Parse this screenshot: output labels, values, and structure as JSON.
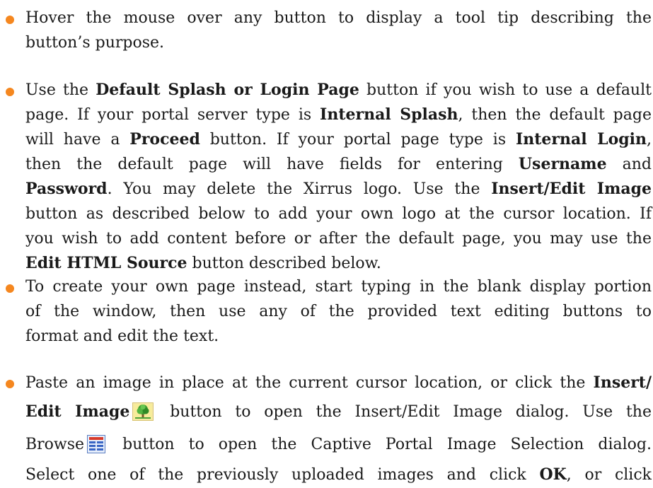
{
  "colors": {
    "bullet": "#f5871f",
    "text": "#1a1a1a"
  },
  "bullets": [
    {
      "lines": [
        "Hover the mouse over any button to display a tool tip describing the",
        "button’s purpose."
      ]
    },
    {
      "l1_a": "Use the ",
      "l1_b": "Default Splash or Login Page",
      "l1_c": " button if you wish to use a default",
      "l2_a": "page. If your portal server type is ",
      "l2_b": "Internal Splash",
      "l2_c": ", then the default page",
      "l3_a": "will have a ",
      "l3_b": "Proceed",
      "l3_c": " button. If your portal page type is ",
      "l3_d": "Internal Login",
      "l3_e": ",",
      "l4_a": "then the default page will have fields for entering ",
      "l4_b": "Username",
      "l4_c": " and",
      "l5_a": "Password",
      "l5_b": ". You may delete the Xirrus logo. Use the ",
      "l5_c": "Insert/Edit Image",
      "l6": "button as described below to add your own logo at the cursor location. If",
      "l7": "you wish to add content before or after the default page, you may use the",
      "l8_a": "Edit HTML Source",
      "l8_b": " button described below."
    },
    {
      "lines": [
        "To create your own page instead, start typing in the blank display portion",
        "of the window, then use any of the provided text editing buttons to",
        "format and edit the text."
      ]
    },
    {
      "l1_a": "Paste an image in place at the current cursor location, or click the ",
      "l1_b": "Insert/",
      "l2_a": "Edit Image",
      "l2_b": " button to open the Insert/Edit Image dialog. Use the",
      "l3_a": "Browse",
      "l3_b": " button to open the Captive Portal Image Selection dialog.",
      "l4_a": "Select one of the previously uploaded images and click ",
      "l4_b": "OK",
      "l4_c": ", or click"
    }
  ],
  "icons": {
    "insert_image": "insert-edit-image-icon",
    "browse": "browse-icon"
  }
}
